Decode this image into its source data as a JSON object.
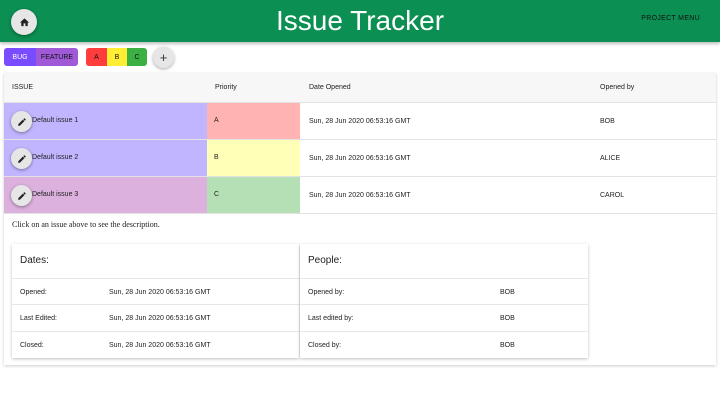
{
  "app": {
    "title": "Issue Tracker",
    "project_menu_label": "PROJECT MENU",
    "accent_color": "#0b8f52"
  },
  "filters": {
    "type_chips": [
      {
        "label": "BUG",
        "color": "#7a4cff"
      },
      {
        "label": "FEATURE",
        "color": "#a05ad8"
      }
    ],
    "priority_chips": [
      {
        "label": "A",
        "color": "#ff3d3d"
      },
      {
        "label": "B",
        "color": "#ffee33"
      },
      {
        "label": "C",
        "color": "#3cb043"
      }
    ],
    "add_label": "+"
  },
  "table": {
    "headers": {
      "issue": "ISSUE",
      "priority": "Priority",
      "date_opened": "Date Opened",
      "opened_by": "Opened by"
    },
    "rows": [
      {
        "name": "Default issue 1",
        "priority": "A",
        "date_opened": "Sun, 28 Jun 2020 06:53:16 GMT",
        "opened_by": "BOB",
        "issue_color": "#c2b5ff",
        "priority_color": "#ffb3b3"
      },
      {
        "name": "Default issue 2",
        "priority": "B",
        "date_opened": "Sun, 28 Jun 2020 06:53:16 GMT",
        "opened_by": "ALICE",
        "issue_color": "#c2b5ff",
        "priority_color": "#ffffb8"
      },
      {
        "name": "Default issue 3",
        "priority": "C",
        "date_opened": "Sun, 28 Jun 2020 06:53:16 GMT",
        "opened_by": "CAROL",
        "issue_color": "#dcb1de",
        "priority_color": "#b5dfb5"
      }
    ]
  },
  "hint": "Click on an issue above to see the description.",
  "details": {
    "dates": {
      "title": "Dates:",
      "opened_label": "Opened:",
      "opened_value": "Sun, 28 Jun 2020 06:53:16 GMT",
      "last_edited_label": "Last Edited:",
      "last_edited_value": "Sun, 28 Jun 2020 06:53:16 GMT",
      "closed_label": "Closed:",
      "closed_value": "Sun, 28 Jun 2020 06:53:16 GMT"
    },
    "people": {
      "title": "People:",
      "opened_by_label": "Opened by:",
      "opened_by_value": "BOB",
      "last_edited_by_label": "Last edited by:",
      "last_edited_by_value": "BOB",
      "closed_by_label": "Closed by:",
      "closed_by_value": "BOB"
    }
  }
}
